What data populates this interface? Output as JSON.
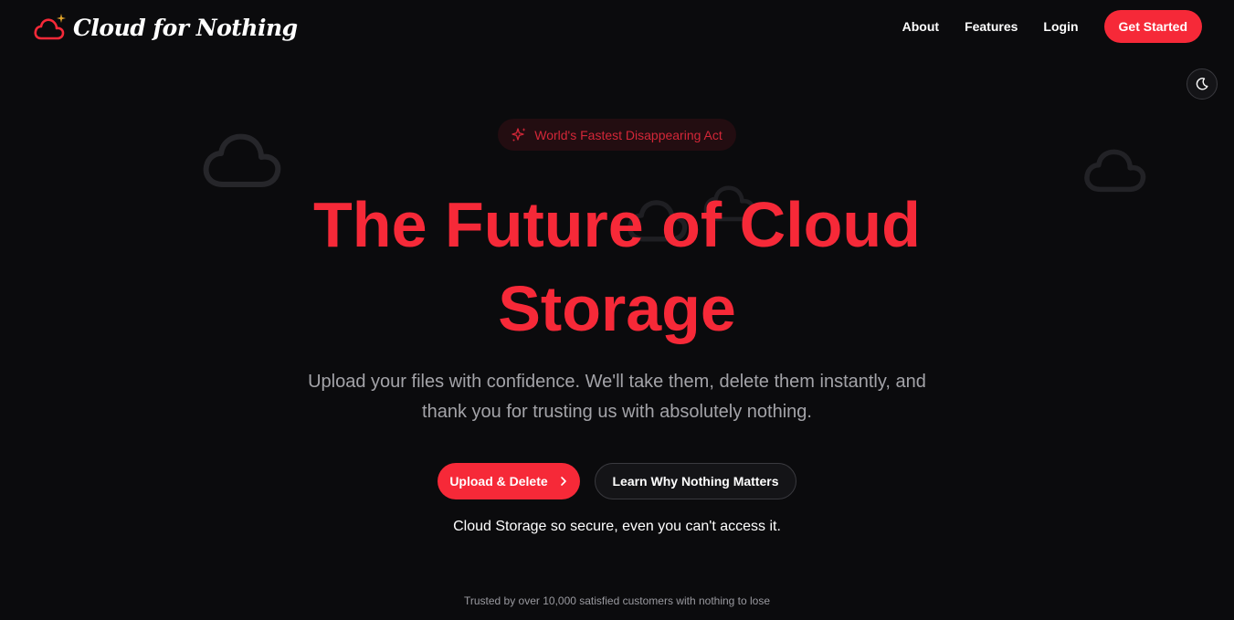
{
  "header": {
    "logo_text": "Cloud for Nothing",
    "nav": {
      "about": "About",
      "features": "Features",
      "login": "Login",
      "cta": "Get Started"
    },
    "theme_toggle_icon": "moon-icon"
  },
  "hero": {
    "badge": {
      "icon": "sparkles-icon",
      "text": "World's Fastest Disappearing Act"
    },
    "title": "The Future of Cloud Storage",
    "subtitle": "Upload your files with confidence. We'll take them, delete them instantly, and thank you for trusting us with absolutely nothing.",
    "primary_button": {
      "label": "Upload & Delete",
      "icon": "chevron-right-icon"
    },
    "secondary_button": {
      "label": "Learn Why Nothing Matters"
    },
    "tagline": "Cloud Storage so secure, even you can't access it.",
    "trust_line": "Trusted by over 10,000 satisfied customers with nothing to lose"
  },
  "colors": {
    "background": "#0b0b0d",
    "accent": "#f62938",
    "muted_text": "#a3a3a8",
    "badge_bg": "#230d11",
    "badge_text": "#d32738"
  }
}
